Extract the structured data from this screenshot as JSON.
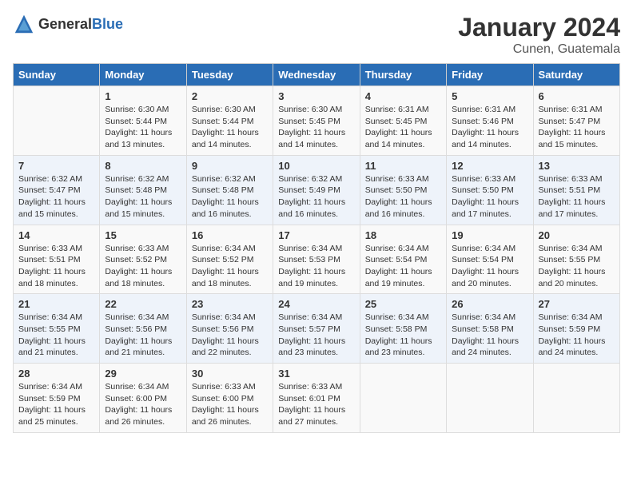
{
  "header": {
    "logo_general": "General",
    "logo_blue": "Blue",
    "month_title": "January 2024",
    "location": "Cunen, Guatemala"
  },
  "days_of_week": [
    "Sunday",
    "Monday",
    "Tuesday",
    "Wednesday",
    "Thursday",
    "Friday",
    "Saturday"
  ],
  "weeks": [
    [
      {
        "day": "",
        "info": ""
      },
      {
        "day": "1",
        "info": "Sunrise: 6:30 AM\nSunset: 5:44 PM\nDaylight: 11 hours\nand 13 minutes."
      },
      {
        "day": "2",
        "info": "Sunrise: 6:30 AM\nSunset: 5:44 PM\nDaylight: 11 hours\nand 14 minutes."
      },
      {
        "day": "3",
        "info": "Sunrise: 6:30 AM\nSunset: 5:45 PM\nDaylight: 11 hours\nand 14 minutes."
      },
      {
        "day": "4",
        "info": "Sunrise: 6:31 AM\nSunset: 5:45 PM\nDaylight: 11 hours\nand 14 minutes."
      },
      {
        "day": "5",
        "info": "Sunrise: 6:31 AM\nSunset: 5:46 PM\nDaylight: 11 hours\nand 14 minutes."
      },
      {
        "day": "6",
        "info": "Sunrise: 6:31 AM\nSunset: 5:47 PM\nDaylight: 11 hours\nand 15 minutes."
      }
    ],
    [
      {
        "day": "7",
        "info": "Sunrise: 6:32 AM\nSunset: 5:47 PM\nDaylight: 11 hours\nand 15 minutes."
      },
      {
        "day": "8",
        "info": "Sunrise: 6:32 AM\nSunset: 5:48 PM\nDaylight: 11 hours\nand 15 minutes."
      },
      {
        "day": "9",
        "info": "Sunrise: 6:32 AM\nSunset: 5:48 PM\nDaylight: 11 hours\nand 16 minutes."
      },
      {
        "day": "10",
        "info": "Sunrise: 6:32 AM\nSunset: 5:49 PM\nDaylight: 11 hours\nand 16 minutes."
      },
      {
        "day": "11",
        "info": "Sunrise: 6:33 AM\nSunset: 5:50 PM\nDaylight: 11 hours\nand 16 minutes."
      },
      {
        "day": "12",
        "info": "Sunrise: 6:33 AM\nSunset: 5:50 PM\nDaylight: 11 hours\nand 17 minutes."
      },
      {
        "day": "13",
        "info": "Sunrise: 6:33 AM\nSunset: 5:51 PM\nDaylight: 11 hours\nand 17 minutes."
      }
    ],
    [
      {
        "day": "14",
        "info": "Sunrise: 6:33 AM\nSunset: 5:51 PM\nDaylight: 11 hours\nand 18 minutes."
      },
      {
        "day": "15",
        "info": "Sunrise: 6:33 AM\nSunset: 5:52 PM\nDaylight: 11 hours\nand 18 minutes."
      },
      {
        "day": "16",
        "info": "Sunrise: 6:34 AM\nSunset: 5:52 PM\nDaylight: 11 hours\nand 18 minutes."
      },
      {
        "day": "17",
        "info": "Sunrise: 6:34 AM\nSunset: 5:53 PM\nDaylight: 11 hours\nand 19 minutes."
      },
      {
        "day": "18",
        "info": "Sunrise: 6:34 AM\nSunset: 5:54 PM\nDaylight: 11 hours\nand 19 minutes."
      },
      {
        "day": "19",
        "info": "Sunrise: 6:34 AM\nSunset: 5:54 PM\nDaylight: 11 hours\nand 20 minutes."
      },
      {
        "day": "20",
        "info": "Sunrise: 6:34 AM\nSunset: 5:55 PM\nDaylight: 11 hours\nand 20 minutes."
      }
    ],
    [
      {
        "day": "21",
        "info": "Sunrise: 6:34 AM\nSunset: 5:55 PM\nDaylight: 11 hours\nand 21 minutes."
      },
      {
        "day": "22",
        "info": "Sunrise: 6:34 AM\nSunset: 5:56 PM\nDaylight: 11 hours\nand 21 minutes."
      },
      {
        "day": "23",
        "info": "Sunrise: 6:34 AM\nSunset: 5:56 PM\nDaylight: 11 hours\nand 22 minutes."
      },
      {
        "day": "24",
        "info": "Sunrise: 6:34 AM\nSunset: 5:57 PM\nDaylight: 11 hours\nand 23 minutes."
      },
      {
        "day": "25",
        "info": "Sunrise: 6:34 AM\nSunset: 5:58 PM\nDaylight: 11 hours\nand 23 minutes."
      },
      {
        "day": "26",
        "info": "Sunrise: 6:34 AM\nSunset: 5:58 PM\nDaylight: 11 hours\nand 24 minutes."
      },
      {
        "day": "27",
        "info": "Sunrise: 6:34 AM\nSunset: 5:59 PM\nDaylight: 11 hours\nand 24 minutes."
      }
    ],
    [
      {
        "day": "28",
        "info": "Sunrise: 6:34 AM\nSunset: 5:59 PM\nDaylight: 11 hours\nand 25 minutes."
      },
      {
        "day": "29",
        "info": "Sunrise: 6:34 AM\nSunset: 6:00 PM\nDaylight: 11 hours\nand 26 minutes."
      },
      {
        "day": "30",
        "info": "Sunrise: 6:33 AM\nSunset: 6:00 PM\nDaylight: 11 hours\nand 26 minutes."
      },
      {
        "day": "31",
        "info": "Sunrise: 6:33 AM\nSunset: 6:01 PM\nDaylight: 11 hours\nand 27 minutes."
      },
      {
        "day": "",
        "info": ""
      },
      {
        "day": "",
        "info": ""
      },
      {
        "day": "",
        "info": ""
      }
    ]
  ]
}
